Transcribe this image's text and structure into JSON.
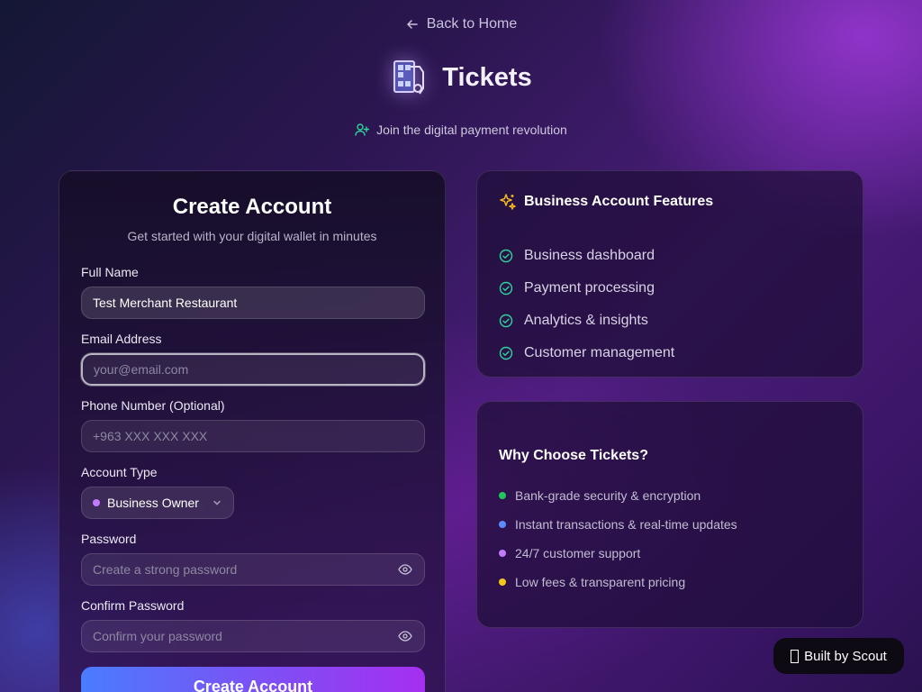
{
  "nav": {
    "back_label": "Back to Home"
  },
  "brand": {
    "name": "Tickets",
    "icon": "qr-ticket-icon"
  },
  "tagline": {
    "text": "Join the digital payment revolution",
    "icon": "user-plus-icon"
  },
  "form": {
    "title": "Create Account",
    "subtitle": "Get started with your digital wallet in minutes",
    "full_name": {
      "label": "Full Name",
      "value": "Test Merchant Restaurant",
      "placeholder": ""
    },
    "email": {
      "label": "Email Address",
      "value": "",
      "placeholder": "your@email.com"
    },
    "phone": {
      "label": "Phone Number (Optional)",
      "value": "",
      "placeholder": "+963 XXX XXX XXX"
    },
    "account_type": {
      "label": "Account Type",
      "selected": "Business Owner",
      "dot_color": "#c17bff"
    },
    "password": {
      "label": "Password",
      "placeholder": "Create a strong password"
    },
    "confirm_password": {
      "label": "Confirm Password",
      "placeholder": "Confirm your password"
    },
    "submit_label": "Create Account"
  },
  "features": {
    "title": "Business Account Features",
    "icon": "sparkles-icon",
    "items": [
      {
        "label": "Business dashboard"
      },
      {
        "label": "Payment processing"
      },
      {
        "label": "Analytics & insights"
      },
      {
        "label": "Customer management"
      }
    ],
    "check_color": "#2fd39a"
  },
  "why": {
    "title": "Why Choose Tickets?",
    "items": [
      {
        "label": "Bank-grade security & encryption",
        "color": "#22c55e"
      },
      {
        "label": "Instant transactions & real-time updates",
        "color": "#5b8cff"
      },
      {
        "label": "24/7 customer support",
        "color": "#c17bff"
      },
      {
        "label": "Low fees & transparent pricing",
        "color": "#f5c518"
      }
    ]
  },
  "footer_badge": {
    "label": "Built by Scout"
  }
}
